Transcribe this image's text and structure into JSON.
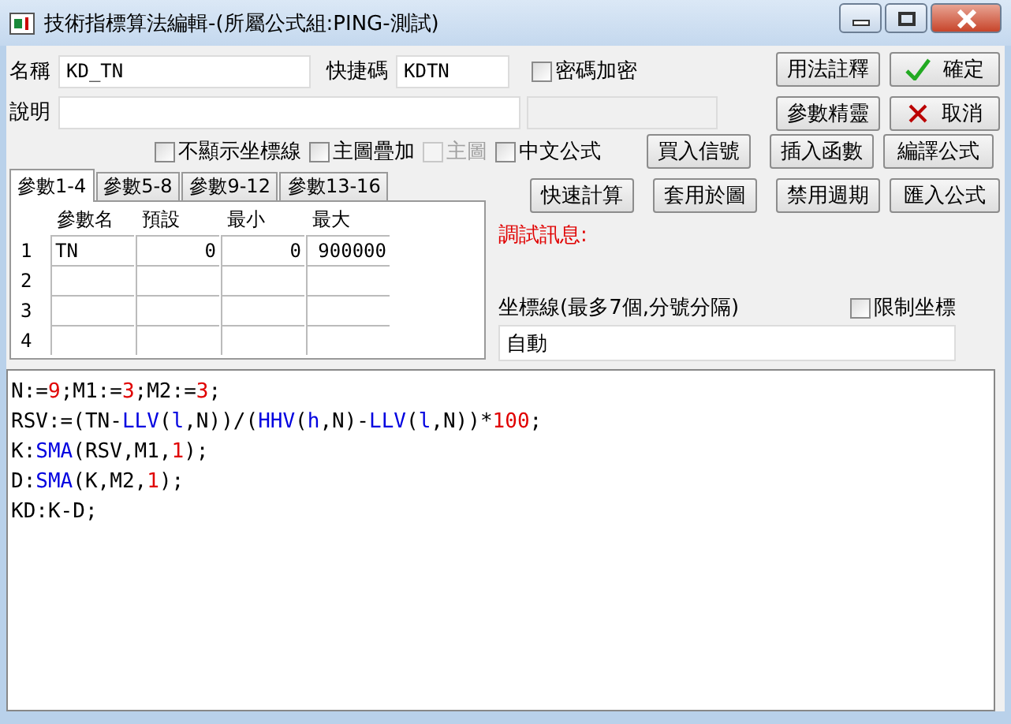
{
  "window": {
    "title": "技術指標算法編輯-(所屬公式組:PING-測試)"
  },
  "name_field": {
    "label": "名稱",
    "value": "KD_TN"
  },
  "shortcut_field": {
    "label": "快捷碼",
    "value": "KDTN"
  },
  "password_checkbox": {
    "label": "密碼加密",
    "checked": false
  },
  "description_field": {
    "label": "說明"
  },
  "top_buttons": [
    {
      "label": "用法註釋",
      "kind": "plain"
    },
    {
      "label": "確定",
      "kind": "ok"
    },
    {
      "label": "參數精靈",
      "kind": "plain"
    },
    {
      "label": "取消",
      "kind": "cancel"
    }
  ],
  "options": [
    {
      "label": "不顯示坐標線",
      "checked": false,
      "disabled": false
    },
    {
      "label": "主圖疊加",
      "checked": false,
      "disabled": false
    },
    {
      "label": "主圖",
      "checked": false,
      "disabled": true
    },
    {
      "label": "中文公式",
      "checked": false,
      "disabled": false
    }
  ],
  "row3_buttons": [
    "買入信號",
    "插入函數",
    "編譯公式"
  ],
  "row4_buttons": [
    "快速計算",
    "套用於圖",
    "禁用週期",
    "匯入公式"
  ],
  "tabs": [
    {
      "label": "參數1-4",
      "selected": true
    },
    {
      "label": "參數5-8",
      "selected": false
    },
    {
      "label": "參數9-12",
      "selected": false
    },
    {
      "label": "參數13-16",
      "selected": false
    }
  ],
  "table": {
    "columns": [
      "參數名",
      "預設",
      "最小",
      "最大"
    ],
    "rows": [
      {
        "index": "1",
        "cells": [
          "TN",
          "0",
          "0",
          "900000"
        ]
      },
      {
        "index": "2",
        "cells": []
      },
      {
        "index": "3",
        "cells": []
      },
      {
        "index": "4",
        "cells": []
      }
    ]
  },
  "debug_label": "調試訊息:",
  "axis_lines": {
    "label": "坐標線(最多7個,分號分隔)",
    "limit_checkbox": {
      "label": "限制坐標",
      "checked": false
    },
    "value": "自動"
  },
  "editor": {
    "lines": [
      [
        {
          "text": "N:=",
          "kind": "plain"
        },
        {
          "text": "9",
          "kind": "number"
        },
        {
          "text": ";M1:=",
          "kind": "plain"
        },
        {
          "text": "3",
          "kind": "number"
        },
        {
          "text": ";M2:=",
          "kind": "plain"
        },
        {
          "text": "3",
          "kind": "number"
        },
        {
          "text": ";",
          "kind": "plain"
        }
      ],
      [
        {
          "text": "RSV:=(TN-",
          "kind": "plain"
        },
        {
          "text": "LLV",
          "kind": "function"
        },
        {
          "text": "(",
          "kind": "plain"
        },
        {
          "text": "l",
          "kind": "function"
        },
        {
          "text": ",N))/(",
          "kind": "plain"
        },
        {
          "text": "HHV",
          "kind": "function"
        },
        {
          "text": "(",
          "kind": "plain"
        },
        {
          "text": "h",
          "kind": "function"
        },
        {
          "text": ",N)-",
          "kind": "plain"
        },
        {
          "text": "LLV",
          "kind": "function"
        },
        {
          "text": "(",
          "kind": "plain"
        },
        {
          "text": "l",
          "kind": "function"
        },
        {
          "text": ",N))*",
          "kind": "plain"
        },
        {
          "text": "100",
          "kind": "number"
        },
        {
          "text": ";",
          "kind": "plain"
        }
      ],
      [
        {
          "text": "K:",
          "kind": "plain"
        },
        {
          "text": "SMA",
          "kind": "function"
        },
        {
          "text": "(RSV,M1,",
          "kind": "plain"
        },
        {
          "text": "1",
          "kind": "number"
        },
        {
          "text": ");",
          "kind": "plain"
        }
      ],
      [
        {
          "text": "D:",
          "kind": "plain"
        },
        {
          "text": "SMA",
          "kind": "function"
        },
        {
          "text": "(K,M2,",
          "kind": "plain"
        },
        {
          "text": "1",
          "kind": "number"
        },
        {
          "text": ");",
          "kind": "plain"
        }
      ],
      [
        {
          "text": "KD:K-D;",
          "kind": "plain"
        }
      ]
    ]
  }
}
